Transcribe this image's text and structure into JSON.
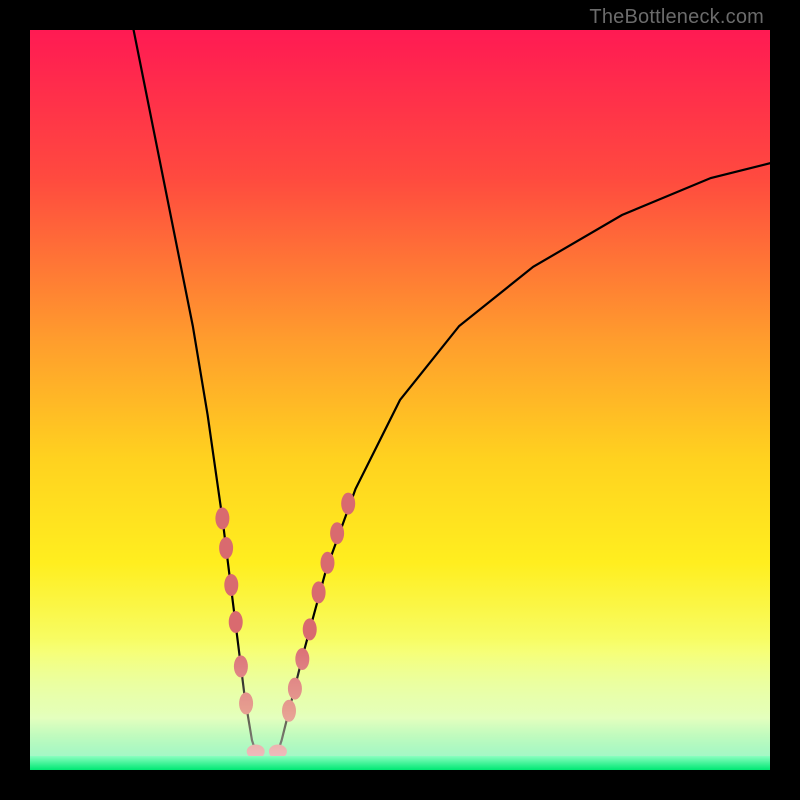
{
  "watermark": {
    "text": "TheBottleneck.com"
  },
  "chart_data": {
    "type": "line",
    "title": "",
    "xlabel": "",
    "ylabel": "",
    "xlim": [
      0,
      100
    ],
    "ylim": [
      0,
      100
    ],
    "curve": {
      "x": [
        14,
        16,
        18,
        20,
        22,
        24,
        26,
        27,
        28,
        29,
        30,
        31,
        32,
        33,
        34,
        35,
        37,
        40,
        44,
        50,
        58,
        68,
        80,
        92,
        100
      ],
      "y": [
        100,
        90,
        80,
        70,
        60,
        48,
        34,
        26,
        18,
        10,
        4,
        1,
        0,
        1,
        4,
        8,
        16,
        27,
        38,
        50,
        60,
        68,
        75,
        80,
        82
      ]
    },
    "markers_left": {
      "x": [
        26.0,
        26.5,
        27.2,
        27.8,
        28.5,
        29.2
      ],
      "y": [
        34,
        30,
        25,
        20,
        14,
        9
      ]
    },
    "markers_right": {
      "x": [
        35.0,
        35.8,
        36.8,
        37.8,
        39.0,
        40.2,
        41.5,
        43.0
      ],
      "y": [
        8,
        11,
        15,
        19,
        24,
        28,
        32,
        36
      ]
    },
    "markers_bottom": {
      "x": [
        30.5,
        31.3,
        32.0,
        32.7,
        33.5
      ],
      "y": [
        2.5,
        1.0,
        0.5,
        1.0,
        2.5
      ]
    },
    "background_gradient": {
      "stops": [
        {
          "offset": 0.0,
          "color": "#ff1a53"
        },
        {
          "offset": 0.2,
          "color": "#ff4a3f"
        },
        {
          "offset": 0.42,
          "color": "#ff9d2d"
        },
        {
          "offset": 0.58,
          "color": "#ffd21f"
        },
        {
          "offset": 0.72,
          "color": "#ffee1f"
        },
        {
          "offset": 0.84,
          "color": "#f6ff6e"
        },
        {
          "offset": 0.93,
          "color": "#d3ffb0"
        },
        {
          "offset": 1.0,
          "color": "#00e874"
        }
      ]
    },
    "marker_color": "#d96a6f",
    "curve_color": "#000000"
  }
}
